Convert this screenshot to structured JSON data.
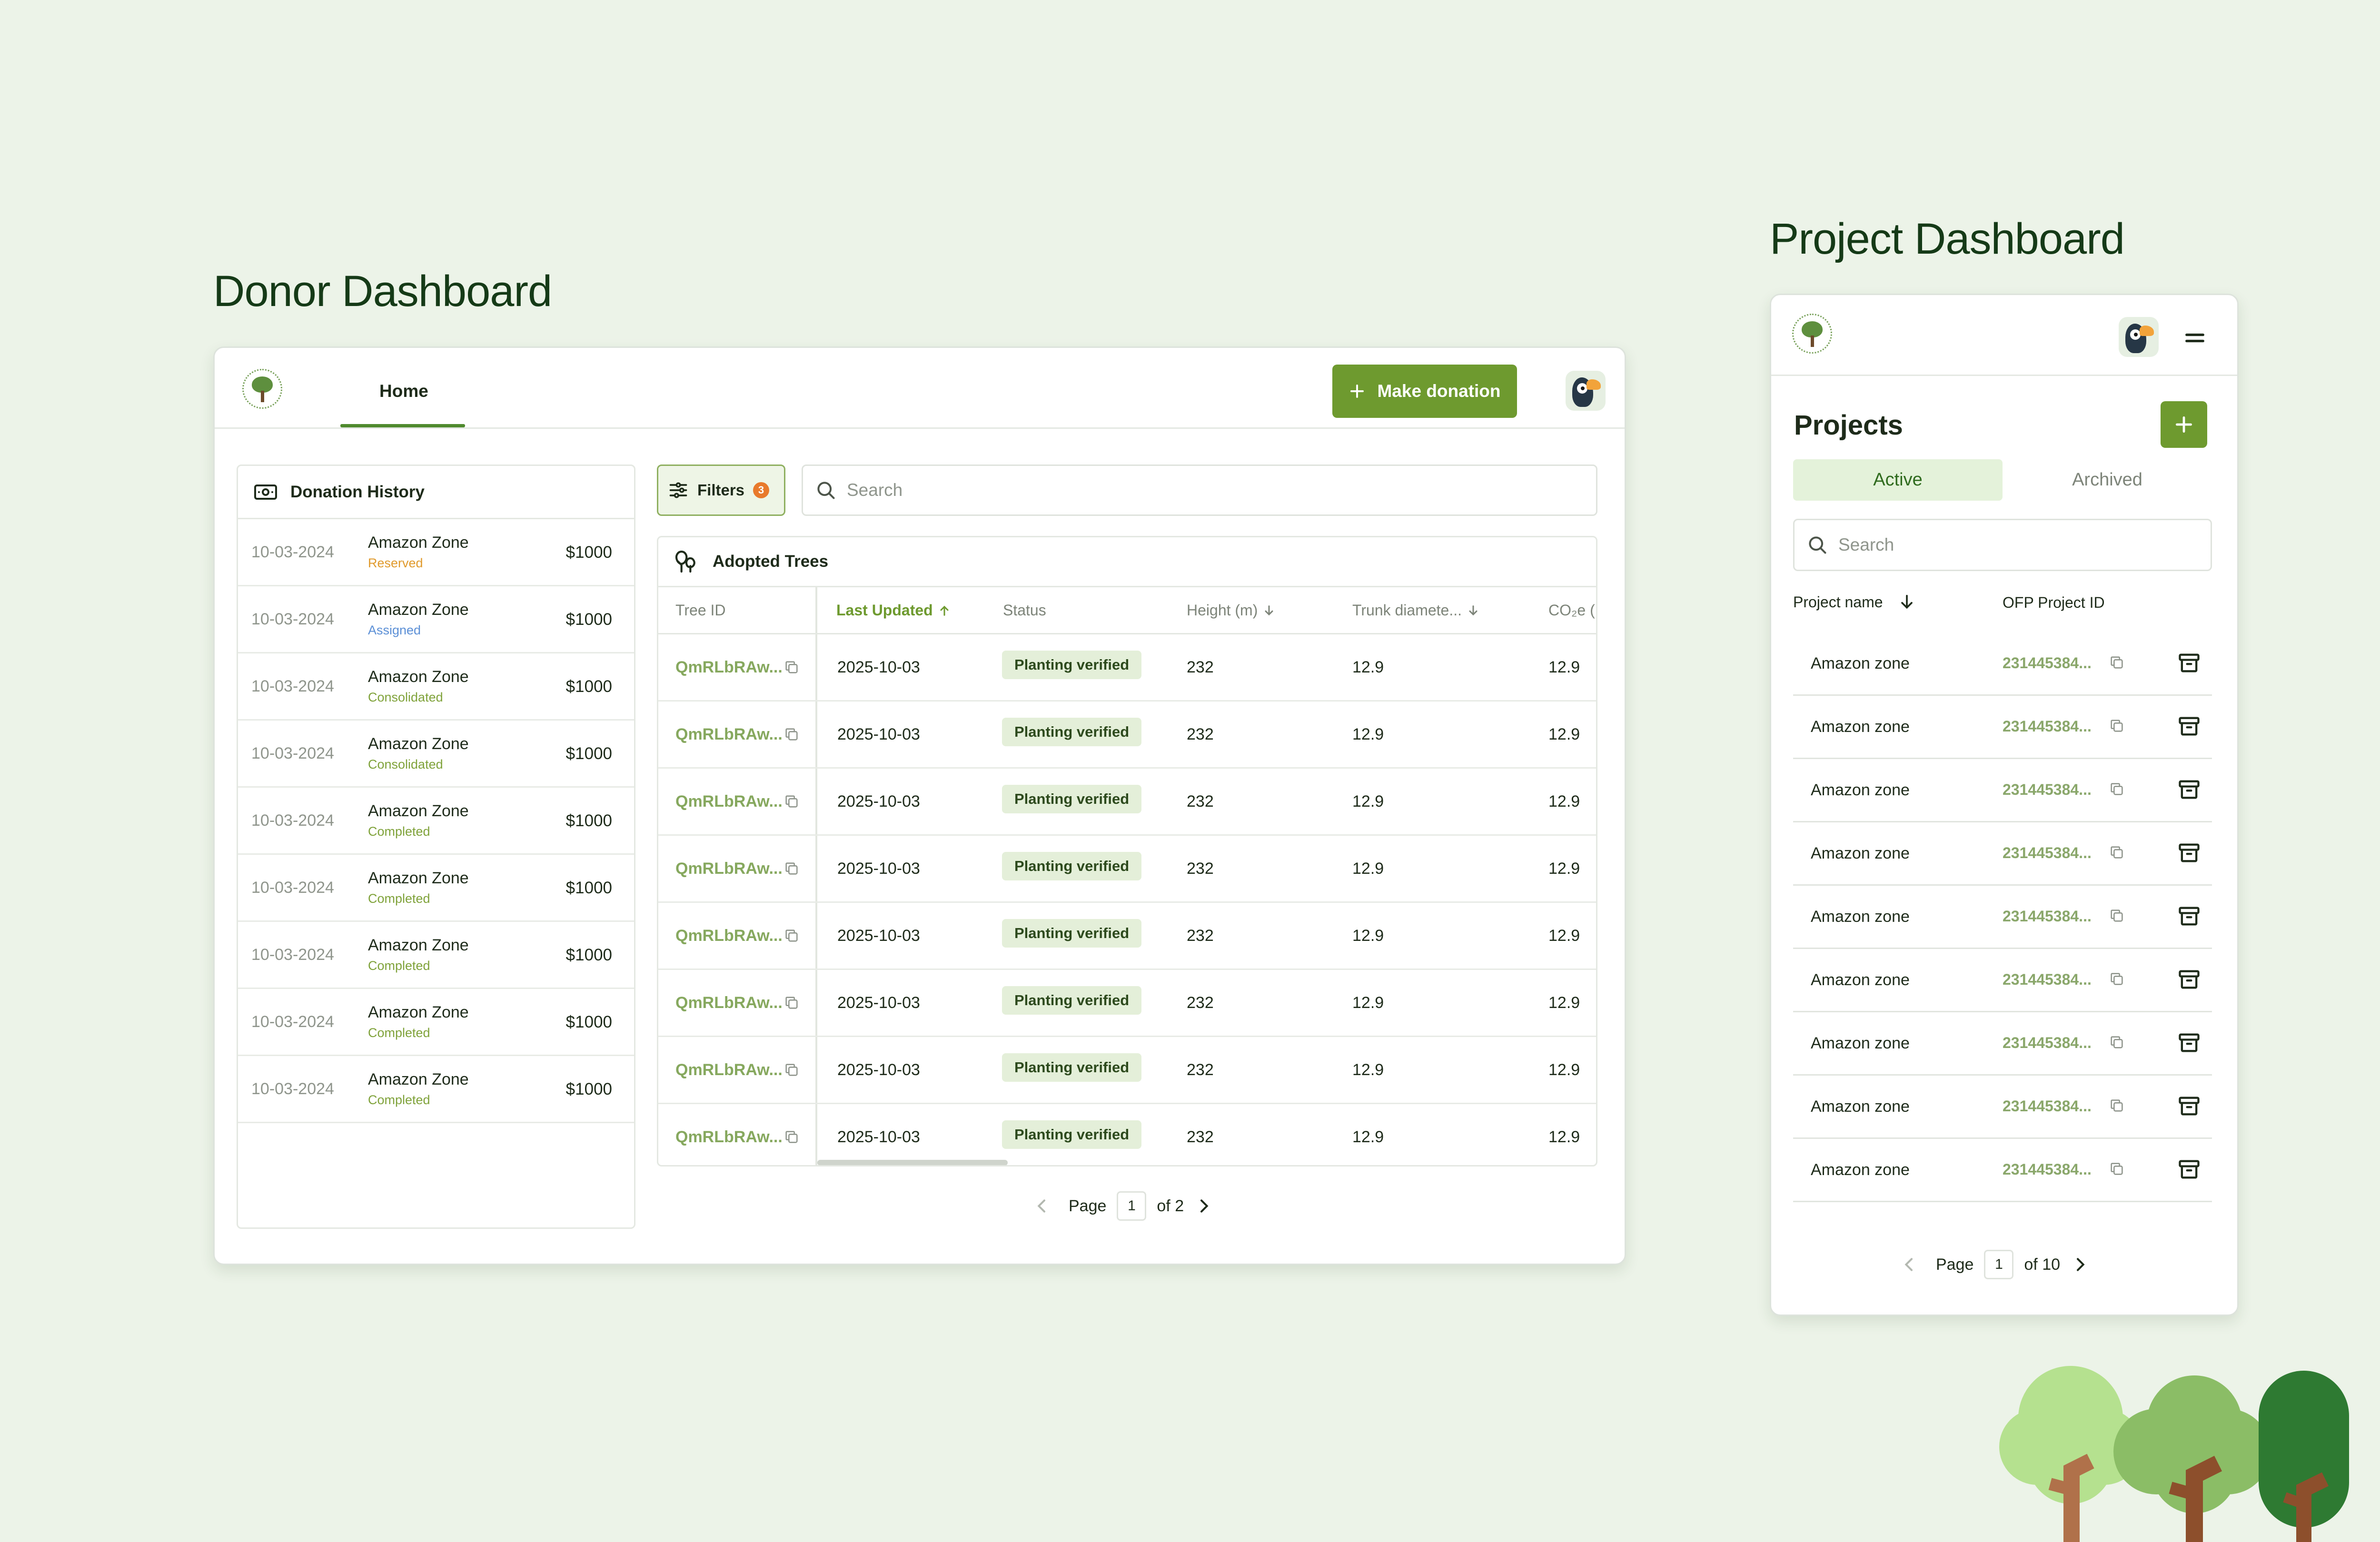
{
  "donor": {
    "section_title": "Donor Dashboard",
    "nav": {
      "home_tab": "Home"
    },
    "make_donation_label": "Make donation",
    "history": {
      "title": "Donation History",
      "rows": [
        {
          "date": "10-03-2024",
          "name": "Amazon Zone",
          "status": "Reserved",
          "status_color": "#e09a2c",
          "amount": "$1000"
        },
        {
          "date": "10-03-2024",
          "name": "Amazon Zone",
          "status": "Assigned",
          "status_color": "#5b8fd6",
          "amount": "$1000"
        },
        {
          "date": "10-03-2024",
          "name": "Amazon Zone",
          "status": "Consolidated",
          "status_color": "#7fa23a",
          "amount": "$1000"
        },
        {
          "date": "10-03-2024",
          "name": "Amazon Zone",
          "status": "Consolidated",
          "status_color": "#7fa23a",
          "amount": "$1000"
        },
        {
          "date": "10-03-2024",
          "name": "Amazon Zone",
          "status": "Completed",
          "status_color": "#7fa23a",
          "amount": "$1000"
        },
        {
          "date": "10-03-2024",
          "name": "Amazon Zone",
          "status": "Completed",
          "status_color": "#7fa23a",
          "amount": "$1000"
        },
        {
          "date": "10-03-2024",
          "name": "Amazon Zone",
          "status": "Completed",
          "status_color": "#7fa23a",
          "amount": "$1000"
        },
        {
          "date": "10-03-2024",
          "name": "Amazon Zone",
          "status": "Completed",
          "status_color": "#7fa23a",
          "amount": "$1000"
        },
        {
          "date": "10-03-2024",
          "name": "Amazon Zone",
          "status": "Completed",
          "status_color": "#7fa23a",
          "amount": "$1000"
        }
      ]
    },
    "filters_label": "Filters",
    "filters_count": "3",
    "search_placeholder": "Search",
    "trees": {
      "title": "Adopted Trees",
      "columns": [
        "Tree ID",
        "Last Updated",
        "Status",
        "Height (m)",
        "Trunk diamete...",
        "CO₂e ("
      ],
      "rows": [
        {
          "id": "QmRLbRAw...",
          "updated": "2025-10-03",
          "status": "Planting verified",
          "height": "232",
          "trunk": "12.9",
          "co2": "12.9"
        },
        {
          "id": "QmRLbRAw...",
          "updated": "2025-10-03",
          "status": "Planting verified",
          "height": "232",
          "trunk": "12.9",
          "co2": "12.9"
        },
        {
          "id": "QmRLbRAw...",
          "updated": "2025-10-03",
          "status": "Planting verified",
          "height": "232",
          "trunk": "12.9",
          "co2": "12.9"
        },
        {
          "id": "QmRLbRAw...",
          "updated": "2025-10-03",
          "status": "Planting verified",
          "height": "232",
          "trunk": "12.9",
          "co2": "12.9"
        },
        {
          "id": "QmRLbRAw...",
          "updated": "2025-10-03",
          "status": "Planting verified",
          "height": "232",
          "trunk": "12.9",
          "co2": "12.9"
        },
        {
          "id": "QmRLbRAw...",
          "updated": "2025-10-03",
          "status": "Planting verified",
          "height": "232",
          "trunk": "12.9",
          "co2": "12.9"
        },
        {
          "id": "QmRLbRAw...",
          "updated": "2025-10-03",
          "status": "Planting verified",
          "height": "232",
          "trunk": "12.9",
          "co2": "12.9"
        },
        {
          "id": "QmRLbRAw...",
          "updated": "2025-10-03",
          "status": "Planting verified",
          "height": "232",
          "trunk": "12.9",
          "co2": "12.9"
        }
      ]
    },
    "pager": {
      "label": "Page",
      "current": "1",
      "total": "of 2"
    }
  },
  "project": {
    "section_title": "Project Dashboard",
    "projects_title": "Projects",
    "tabs": {
      "active": "Active",
      "archived": "Archived"
    },
    "search_placeholder": "Search",
    "columns": {
      "name": "Project name",
      "id": "OFP Project ID"
    },
    "rows": [
      {
        "name": "Amazon zone",
        "id": "231445384..."
      },
      {
        "name": "Amazon zone",
        "id": "231445384..."
      },
      {
        "name": "Amazon zone",
        "id": "231445384..."
      },
      {
        "name": "Amazon zone",
        "id": "231445384..."
      },
      {
        "name": "Amazon zone",
        "id": "231445384..."
      },
      {
        "name": "Amazon zone",
        "id": "231445384..."
      },
      {
        "name": "Amazon zone",
        "id": "231445384..."
      },
      {
        "name": "Amazon zone",
        "id": "231445384..."
      },
      {
        "name": "Amazon zone",
        "id": "231445384..."
      }
    ],
    "pager": {
      "label": "Page",
      "current": "1",
      "total": "of 10"
    }
  },
  "colors": {
    "accent": "#6e9a2f",
    "background": "#ecf3e8",
    "title": "#153a17",
    "tree_id": "#86a85e"
  },
  "icons": [
    "logo",
    "toucan-avatar",
    "plus-icon",
    "cash-icon",
    "filter-icon",
    "search-icon",
    "trees-icon",
    "copy-icon",
    "arrow-up-icon",
    "arrow-down-icon",
    "archive-icon",
    "menu-icon",
    "chevron-left-icon",
    "chevron-right-icon"
  ]
}
